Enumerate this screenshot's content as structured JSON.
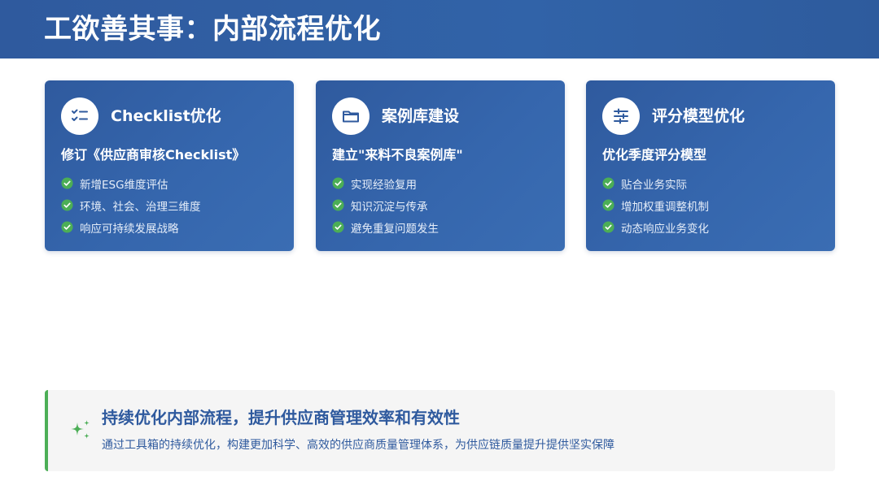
{
  "header": {
    "title": "工欲善其事：内部流程优化"
  },
  "cards": [
    {
      "icon": "checklist-icon",
      "title": "Checklist优化",
      "subtitle": "修订《供应商审核Checklist》",
      "bullets": [
        "新增ESG维度评估",
        "环境、社会、治理三维度",
        "响应可持续发展战略"
      ]
    },
    {
      "icon": "folder-icon",
      "title": "案例库建设",
      "subtitle": "建立\"来料不良案例库\"",
      "bullets": [
        "实现经验复用",
        "知识沉淀与传承",
        "避免重复问题发生"
      ]
    },
    {
      "icon": "sliders-icon",
      "title": "评分模型优化",
      "subtitle": "优化季度评分模型",
      "bullets": [
        "贴合业务实际",
        "增加权重调整机制",
        "动态响应业务变化"
      ]
    }
  ],
  "summary": {
    "icon": "sparkle-icon",
    "title": "持续优化内部流程，提升供应商管理效率和有效性",
    "text": "通过工具箱的持续优化，构建更加科学、高效的供应商质量管理体系，为供应链质量提升提供坚实保障"
  },
  "colors": {
    "primary": "#2f5a9e",
    "card_gradient_end": "#3a6db3",
    "check_green": "#4cae56",
    "summary_bg": "#f5f5f5"
  }
}
